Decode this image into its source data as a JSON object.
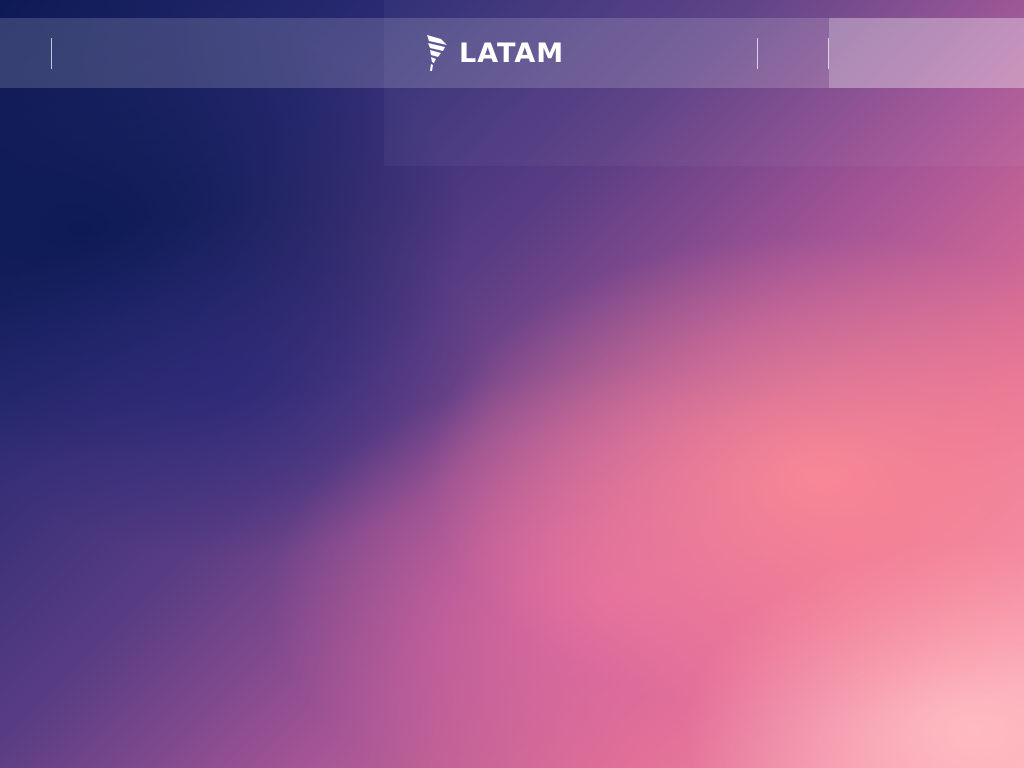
{
  "header": {
    "brand": "LATAM",
    "logo_icon": "latam-logo-icon"
  },
  "colors": {
    "header_bg": "rgba(255,255,255,0.16)",
    "logo": "#ffffff",
    "sky_dark": "#0d1a55",
    "sky_pink": "#ffa5b5"
  }
}
